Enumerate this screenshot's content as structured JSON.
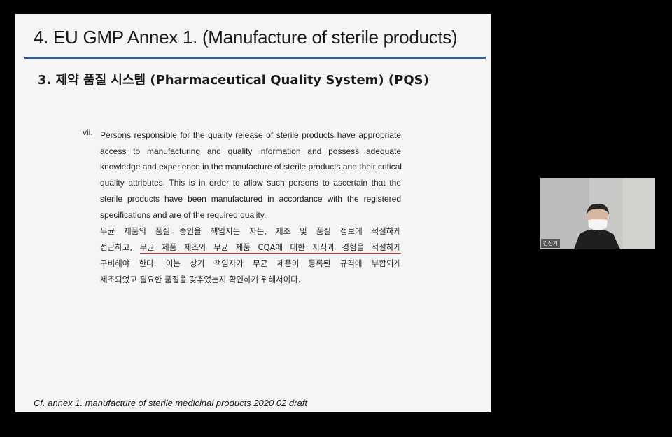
{
  "slide": {
    "title": "4. EU GMP Annex 1. (Manufacture of sterile products)",
    "section_heading": "3. 제약 품질 시스템 (Pharmaceutical Quality System) (PQS)",
    "item": {
      "numeral": "vii.",
      "english_lines": [
        "Persons responsible for the quality release of sterile products have appropriate",
        "access to manufacturing and quality information and possess adequate",
        "knowledge and experience in the manufacture of sterile products and their critical",
        "quality attributes. This is in order to allow such persons to ascertain that the",
        "sterile products have been manufactured in accordance with the registered",
        "specifications and are of the required quality."
      ],
      "korean": {
        "line1": "무균 제품의 품질 승인을 책임지는 자는, 제조 및 품질 정보에 적절하게",
        "line2_plain": "접근하고, ",
        "line2_underlined": "무균 제품 제조와 무균 제품 CQA에 대한 지식과 경험을 적절하게",
        "line3": "구비해야 한다. 이는 상기 책임자가 무균 제품이 등록된 규격에 부합되게",
        "line4": "제조되었고 필요한 품질을 갖추었는지 확인하기 위해서이다."
      }
    },
    "footnote": "Cf. annex 1. manufacture of sterile medicinal products 2020 02 draft",
    "colors": {
      "title_rule": "#2e5c9a",
      "underline": "#d9302b",
      "slide_bg": "#f5f5f5",
      "screen_bg": "#000000"
    }
  },
  "video": {
    "participant_name": "김상기"
  }
}
